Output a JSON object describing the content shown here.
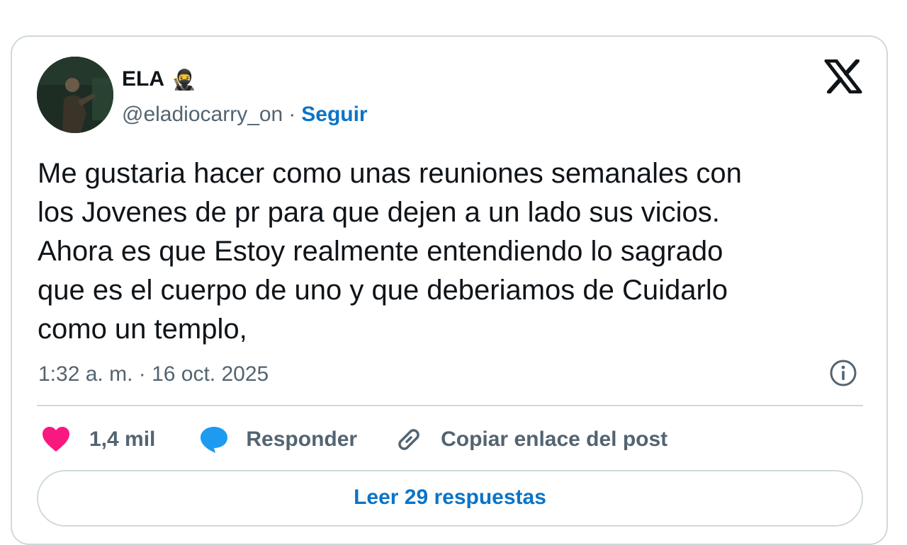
{
  "author": {
    "name": "ELA",
    "emoji": "🥷",
    "handle": "@eladiocarry_on",
    "separator": "·",
    "follow_label": "Seguir"
  },
  "icons": {
    "logo": "x-logo-icon",
    "info": "info-icon",
    "like": "heart-icon",
    "reply": "speech-bubble-icon",
    "copy": "link-icon"
  },
  "tweet": {
    "text": "Me gustaria hacer como unas reuniones semanales con\nlos Jovenes de pr para que dejen a un lado sus vicios.\nAhora es que Estoy realmente entendiendo lo sagrado\nque es el cuerpo de uno y que deberiamos de Cuidarlo\ncomo un templo,",
    "timestamp": "1:32 a. m. · 16 oct. 2025"
  },
  "actions": {
    "likes": "1,4 mil",
    "reply_label": "Responder",
    "copy_label": "Copiar enlace del post"
  },
  "read_replies_label": "Leer 29 respuestas",
  "colors": {
    "accent": "#0b74c8",
    "like": "#f91880",
    "reply": "#1d9bf0",
    "text": "#0f1419",
    "muted": "#536471",
    "border": "#cfd9de"
  }
}
